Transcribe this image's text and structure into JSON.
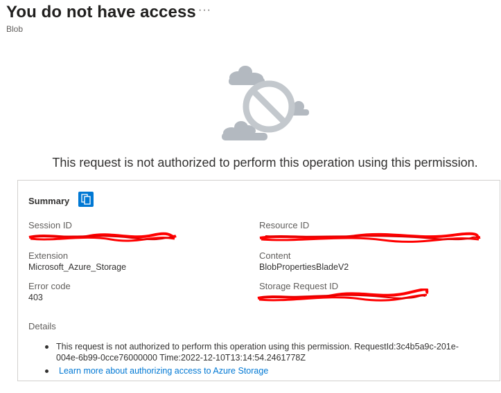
{
  "header": {
    "title": "You do not have access",
    "more_label": "···",
    "subtitle": "Blob"
  },
  "message": "This request is not authorized to perform this operation using this permission.",
  "summary": {
    "heading": "Summary",
    "fields": {
      "session_id": {
        "label": "Session ID"
      },
      "resource_id": {
        "label": "Resource ID"
      },
      "extension": {
        "label": "Extension",
        "value": "Microsoft_Azure_Storage"
      },
      "content": {
        "label": "Content",
        "value": "BlobPropertiesBladeV2"
      },
      "error_code": {
        "label": "Error code",
        "value": "403"
      },
      "storage_request_id": {
        "label": "Storage Request ID"
      }
    },
    "details_heading": "Details",
    "details": {
      "line1": "This request is not authorized to perform this operation using this permission. RequestId:3c4b5a9c-201e-",
      "line2": "004e-6b99-0cce76000000 Time:2022-12-10T13:14:54.2461778Z",
      "link": "Learn more about authorizing access to Azure Storage"
    }
  },
  "colors": {
    "accent": "#0078d4",
    "redaction": "#ff0000",
    "illustration": "#b3b9c0"
  },
  "icons": {
    "more": "ellipsis-icon",
    "copy": "copy-icon",
    "illustration": "no-access-illustration"
  }
}
